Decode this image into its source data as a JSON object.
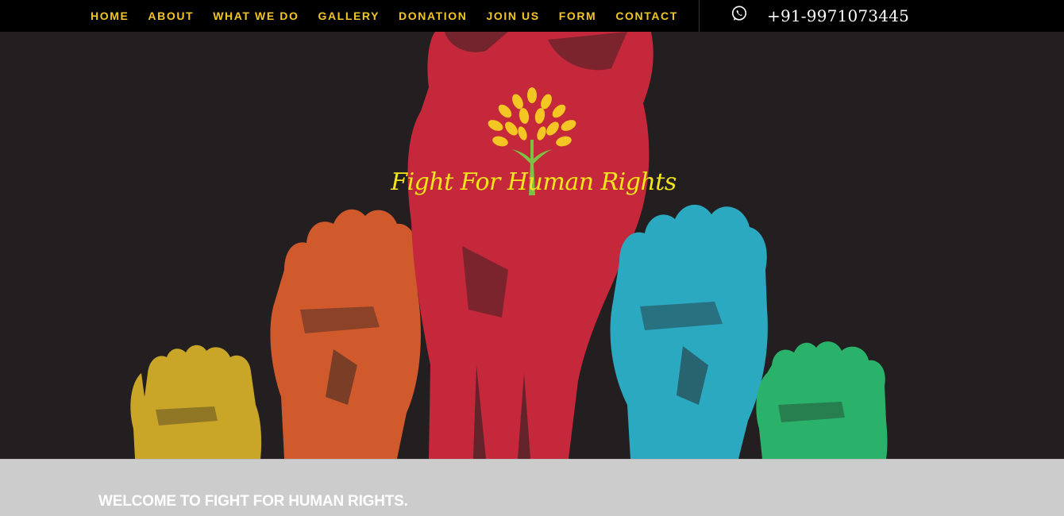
{
  "nav": {
    "items": [
      {
        "label": "HOME"
      },
      {
        "label": "ABOUT"
      },
      {
        "label": "WHAT WE DO"
      },
      {
        "label": "GALLERY"
      },
      {
        "label": "DONATION"
      },
      {
        "label": "JOIN US"
      },
      {
        "label": "FORM"
      },
      {
        "label": "CONTACT"
      }
    ],
    "phone": "+91-9971073445",
    "phone_icon": "whatsapp-icon"
  },
  "hero": {
    "brand": "Fight For Human Rights",
    "logo_icon": "tree-logo-icon"
  },
  "welcome": {
    "title": "WELCOME TO FIGHT FOR HUMAN RIGHTS."
  },
  "colors": {
    "nav_bg": "#000000",
    "nav_text": "#f3c623",
    "hero_bg": "#231f20",
    "fist_red": "#c4283a",
    "fist_orange": "#d15a2d",
    "fist_yellow": "#c9a628",
    "fist_blue": "#2aa9c1",
    "fist_green": "#2ab26a",
    "band_bg": "#cccccc"
  }
}
